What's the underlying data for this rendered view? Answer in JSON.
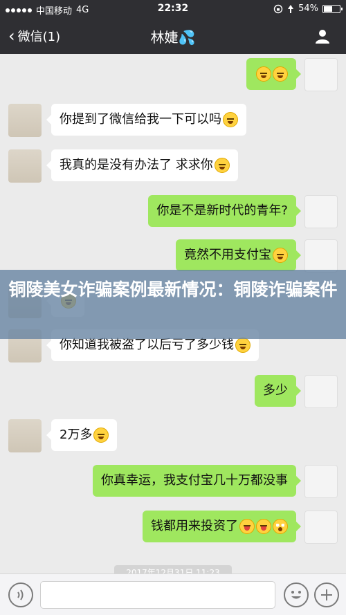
{
  "status_bar": {
    "carrier": "中国移动",
    "network": "4G",
    "time": "22:32",
    "battery": "54%",
    "battery_level": 0.54
  },
  "nav": {
    "back_label": "微信(1)",
    "title": "林婕💦"
  },
  "messages": [
    {
      "side": "out",
      "text": "😂😂"
    },
    {
      "side": "in",
      "text": "你提到了微信给我一下可以吗",
      "emoji": "persevere"
    },
    {
      "side": "in",
      "text": "我真的是没有办法了 求求你",
      "emoji": "persevere"
    },
    {
      "side": "out",
      "text": "你是不是新时代的青年?"
    },
    {
      "side": "out",
      "text": "竟然不用支付宝",
      "emoji": "joy"
    },
    {
      "side": "in",
      "text": "",
      "emoji": "joy"
    },
    {
      "side": "in",
      "text": "你知道我被盗了以后亏了多少钱",
      "emoji": "persevere"
    },
    {
      "side": "out",
      "text": "多少"
    },
    {
      "side": "in",
      "text": "2万多",
      "emoji": "persevere"
    },
    {
      "side": "out",
      "text": "你真幸运，我支付宝几十万都没事"
    },
    {
      "side": "out",
      "text": "钱都用来投资了",
      "emoji": "tongue,tongue,flushed"
    }
  ],
  "overlay_banner": {
    "title": "铜陵美女诈骗案例最新情况：铜陵诈骗案件"
  },
  "timestamp": "2017年12月31日 11:23",
  "colors": {
    "header_bg": "#2f2f33",
    "chat_bg": "#ebebeb",
    "bubble_out": "#9fe75f",
    "bubble_in": "#ffffff"
  },
  "icons": {
    "back": "chevron-left-icon",
    "profile": "person-icon",
    "voice": "voice-icon",
    "emoji": "smiley-icon",
    "more": "plus-icon"
  }
}
